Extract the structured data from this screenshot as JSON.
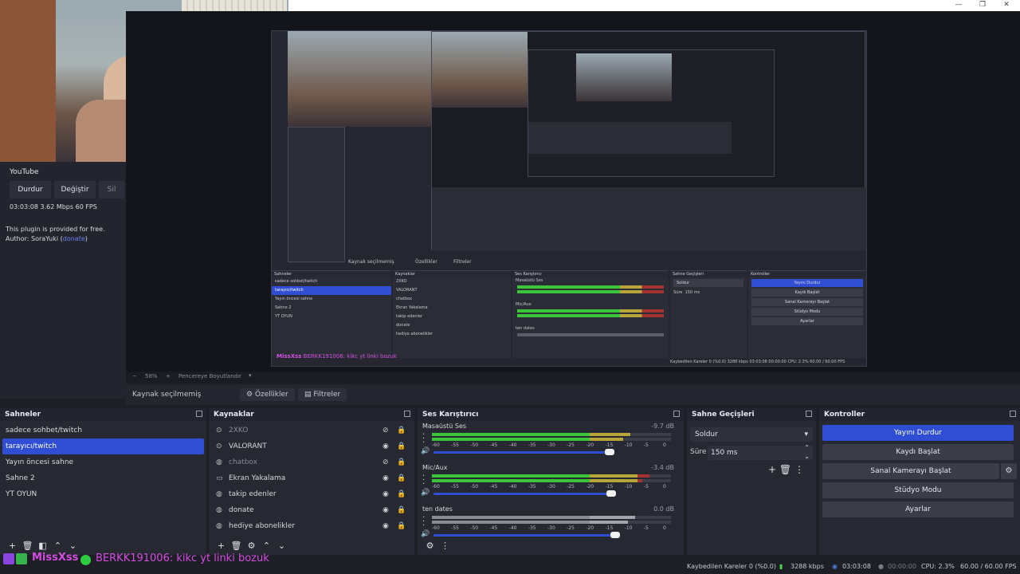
{
  "plugin": {
    "service": "YouTube",
    "stop_label": "Durdur",
    "change_label": "Değiştir",
    "delete_label": "Sil",
    "stats": "03:03:08  3.62 Mbps  60 FPS",
    "notice": "This plugin is provided for free.",
    "author_prefix": "Author: SoraYuki (",
    "author_link": "donate",
    "author_suffix": ")"
  },
  "nested_preview": {
    "source_status": "Kaynak seçilmemiş",
    "props_label": "Özellikler",
    "filters_label": "Filtreler",
    "scenes_title": "Sahneler",
    "sources_title": "Kaynaklar",
    "mixer_title": "Ses Karıştırıcı",
    "transitions_title": "Sahne Geçişleri",
    "controls_title": "Kontroller",
    "scenes": [
      "sadece sohbet/twitch",
      "tarayıcı/twitch",
      "Yayın öncesi sahne",
      "Sahne 2",
      "YT OYUN"
    ],
    "sources": [
      "2XKO",
      "VALORANT",
      "chatbox",
      "Ekran Yakalama",
      "takip edenler",
      "donate",
      "hediye abonelikler"
    ],
    "mixer": [
      {
        "name": "Masaüstü Ses",
        "db": "-9.7 dB"
      },
      {
        "name": "Mic/Aux",
        "db": "-3.4 dB"
      },
      {
        "name": "ten dates",
        "db": "0.0 dB"
      }
    ],
    "transition": "Soldur",
    "duration_label": "Süre",
    "duration": "150 ms",
    "controls": [
      "Yayını Durdur",
      "Kaydı Başlat",
      "Sanal Kamerayı Başlat",
      "Stüdyo Modu",
      "Ayarlar"
    ],
    "chat_user": "MissXss",
    "chat_msg": "BERKK191006: kikc yt linki bozuk",
    "status": "Kaybedilen Kareler 0 (%0.0)   3288 kbps   03:03:08   00:00:00   CPU: 2.3%   60.00 / 60.00 FPS",
    "zoom": "58%",
    "zoom_mode": "Pencereye Boyutlandır"
  },
  "zoom_bar": {
    "minus": "−",
    "percent": "58%",
    "plus": "+",
    "mode": "Pencereye Boyutlandır"
  },
  "source_bar": {
    "status": "Kaynak seçilmemiş",
    "properties": "Özellikler",
    "filters": "Filtreler"
  },
  "docks": {
    "scenes": {
      "title": "Sahneler",
      "items": [
        "sadece sohbet/twitch",
        "tarayıcı/twitch",
        "Yayın öncesi sahne",
        "Sahne 2",
        "YT OYUN"
      ],
      "selected_index": 1
    },
    "sources": {
      "title": "Kaynaklar",
      "items": [
        {
          "label": "2XKO",
          "icon": "gamepad-icon",
          "visible": false
        },
        {
          "label": "VALORANT",
          "icon": "gamepad-icon",
          "visible": true
        },
        {
          "label": "chatbox",
          "icon": "globe-icon",
          "visible": false
        },
        {
          "label": "Ekran Yakalama",
          "icon": "monitor-icon",
          "visible": true
        },
        {
          "label": "takip edenler",
          "icon": "globe-icon",
          "visible": true
        },
        {
          "label": "donate",
          "icon": "globe-icon",
          "visible": true
        },
        {
          "label": "hediye abonelikler",
          "icon": "globe-icon",
          "visible": true
        }
      ]
    },
    "mixer": {
      "title": "Ses Karıştırıcı",
      "scale": [
        "-60",
        "-55",
        "-50",
        "-45",
        "-40",
        "-35",
        "-30",
        "-25",
        "-20",
        "-15",
        "-10",
        "-5",
        "0"
      ],
      "channels": [
        {
          "name": "Masaüstü Ses",
          "db": "-9.7 dB",
          "level": 0.83,
          "volume": 0.97
        },
        {
          "name": "Mic/Aux",
          "db": "-3.4 dB",
          "level": 0.91,
          "volume": 0.98
        },
        {
          "name": "ten dates",
          "db": "0.0 dB",
          "level": 0.85,
          "volume": 1.0
        }
      ]
    },
    "transitions": {
      "title": "Sahne Geçişleri",
      "selected": "Soldur",
      "duration_label": "Süre",
      "duration": "150 ms"
    },
    "controls": {
      "title": "Kontroller",
      "buttons": [
        "Yayını Durdur",
        "Kaydı Başlat",
        "Sanal Kamerayı Başlat",
        "Stüdyo Modu",
        "Ayarlar"
      ]
    }
  },
  "chat": {
    "user": "MissXss",
    "message": "BERKK191006: kikc yt linki bozuk"
  },
  "status": {
    "dropped": "Kaybedilen Kareler 0 (%0.0)",
    "bitrate": "3288 kbps",
    "live_time": "03:03:08",
    "rec_time": "00:00:00",
    "cpu": "CPU: 2.3%",
    "fps": "60.00 / 60.00 FPS"
  },
  "colors": {
    "accent": "#2f4ed4",
    "meter_green": "#3bc53b",
    "meter_yellow": "#b9a43a",
    "meter_red": "#a33333",
    "chat_user": "#d34de0"
  }
}
